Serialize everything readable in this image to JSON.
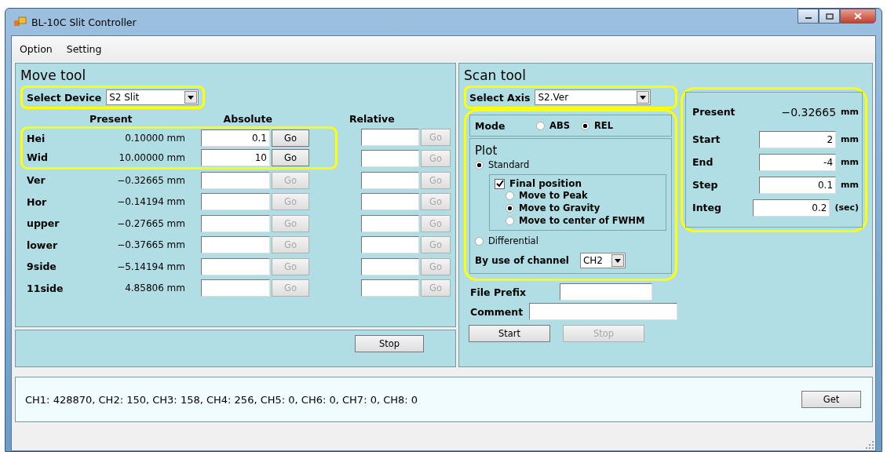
{
  "window": {
    "title": "BL-10C Slit Controller"
  },
  "menu": [
    "Option",
    "Setting"
  ],
  "move_tool": {
    "title": "Move tool",
    "device": {
      "label": "Select Device",
      "value": "S2 Slit",
      "highlighted": true
    },
    "columns": [
      "Present",
      "Absolute",
      "Relative"
    ],
    "rows": [
      {
        "name": "Hei",
        "highlighted": true,
        "present": "0.10000 mm",
        "absolute": "0.1",
        "abs_go": {
          "label": "Go",
          "disabled": false
        },
        "rel_go": {
          "label": "Go",
          "disabled": true
        }
      },
      {
        "name": "Wid",
        "highlighted": true,
        "present": "10.00000 mm",
        "absolute": "10",
        "abs_go": {
          "label": "Go",
          "disabled": false
        },
        "rel_go": {
          "label": "Go",
          "disabled": true
        }
      },
      {
        "name": "Ver",
        "present": "−0.32665 mm",
        "abs_go": {
          "label": "Go",
          "disabled": true
        },
        "rel_go": {
          "label": "Go",
          "disabled": true
        }
      },
      {
        "name": "Hor",
        "present": "−0.14194 mm",
        "abs_go": {
          "label": "Go",
          "disabled": true
        },
        "rel_go": {
          "label": "Go",
          "disabled": true
        }
      },
      {
        "name": "upper",
        "present": "−0.27665 mm",
        "abs_go": {
          "label": "Go",
          "disabled": true
        },
        "rel_go": {
          "label": "Go",
          "disabled": true
        }
      },
      {
        "name": "lower",
        "present": "−0.37665 mm",
        "abs_go": {
          "label": "Go",
          "disabled": true
        },
        "rel_go": {
          "label": "Go",
          "disabled": true
        }
      },
      {
        "name": "9side",
        "present": "−5.14194 mm",
        "abs_go": {
          "label": "Go",
          "disabled": true
        },
        "rel_go": {
          "label": "Go",
          "disabled": true
        }
      },
      {
        "name": "11side",
        "present": "4.85806 mm",
        "abs_go": {
          "label": "Go",
          "disabled": true
        },
        "rel_go": {
          "label": "Go",
          "disabled": true
        }
      }
    ],
    "stop": {
      "label": "Stop",
      "disabled": false
    }
  },
  "scan_tool": {
    "title": "Scan tool",
    "axis": {
      "label": "Select Axis",
      "value": "S2.Ver",
      "highlighted": true
    },
    "settings_highlighted": true,
    "mode": {
      "label": "Mode",
      "options": [
        {
          "label": "ABS",
          "selected": false
        },
        {
          "label": "REL",
          "selected": true
        }
      ]
    },
    "plot": {
      "title": "Plot",
      "standard": {
        "label": "Standard",
        "selected": true
      },
      "final_position": {
        "label": "Final position",
        "checked": true,
        "options": [
          {
            "label": "Move to Peak",
            "selected": false
          },
          {
            "label": "Move to Gravity",
            "selected": true
          },
          {
            "label": "Move to center of FWHM",
            "selected": false
          }
        ]
      },
      "differential": {
        "label": "Differential",
        "selected": false
      },
      "channel": {
        "label": "By use of channel",
        "value": "CH2"
      }
    },
    "file_prefix": {
      "label": "File Prefix"
    },
    "comment": {
      "label": "Comment"
    },
    "buttons": [
      {
        "label": "Start",
        "disabled": false
      },
      {
        "label": "Stop",
        "disabled": true
      }
    ],
    "present": {
      "label": "Present",
      "value": "−0.32665",
      "unit": "mm",
      "highlighted": true
    },
    "params": [
      {
        "label": "Start",
        "value": "2",
        "unit": "mm"
      },
      {
        "label": "End",
        "value": "-4",
        "unit": "mm"
      },
      {
        "label": "Step",
        "value": "0.1",
        "unit": "mm"
      },
      {
        "label": "Integ",
        "value": "0.2",
        "unit": "(sec)"
      }
    ]
  },
  "readout": {
    "text": "CH1: 428870, CH2: 150, CH3: 158, CH4: 256, CH5: 0, CH6: 0, CH7: 0, CH8: 0",
    "button": "Get"
  }
}
